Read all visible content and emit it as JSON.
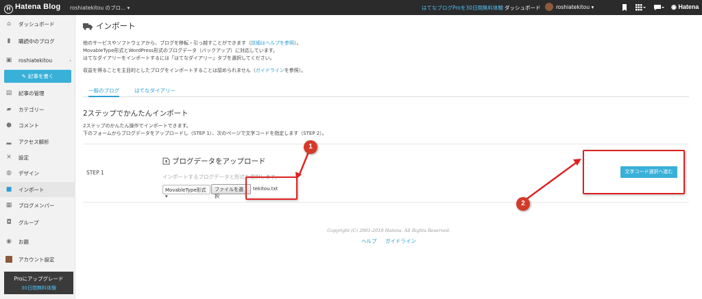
{
  "topbar": {
    "logo": "Hatena Blog",
    "blog_name": "roshiatekitou のブロ... ▾",
    "pro_trial": "はてなブログProを30日間無料体験",
    "dashboard": "ダッシュボード",
    "user": "roshiatekitou ▾",
    "brand": "Hatena"
  },
  "sidebar": {
    "items": [
      {
        "label": "ダッシュボード",
        "icon": "home-icon"
      },
      {
        "label": "購読中のブログ",
        "icon": "bookmark-icon"
      },
      {
        "label": "roshiatekitou",
        "icon": "blog-icon"
      },
      {
        "label": "記事の管理",
        "icon": "document-icon"
      },
      {
        "label": "カテゴリー",
        "icon": "folder-icon"
      },
      {
        "label": "コメント",
        "icon": "comment-icon"
      },
      {
        "label": "アクセス解析",
        "icon": "bar-chart-icon"
      },
      {
        "label": "設定",
        "icon": "wrench-icon"
      },
      {
        "label": "デザイン",
        "icon": "palette-icon"
      },
      {
        "label": "インポート",
        "icon": "truck-icon"
      },
      {
        "label": "ブログメンバー",
        "icon": "members-icon"
      },
      {
        "label": "グループ",
        "icon": "group-icon"
      },
      {
        "label": "お題",
        "icon": "topic-icon"
      },
      {
        "label": "アカウント設定",
        "icon": "avatar-icon"
      }
    ],
    "write_button": "記事を書く",
    "upgrade_title": "Proにアップグレード",
    "upgrade_sub": "30日間無料体験"
  },
  "main": {
    "title": "インポート",
    "desc1_a": "他のサービスやソフトウェアから、ブログを移転・引っ越すことができます（",
    "desc1_link": "詳細はヘルプを参照",
    "desc1_b": "）。",
    "desc2": "MovableType形式とWordPress形式のブログデータ（バックアップ）に対応しています。",
    "desc3": "はてなダイアリーをインポートするには「はてなダイアリー」タブを選択してください。",
    "desc4_a": "収益を得ることを主目的としたブログをインポートすることは認められません（",
    "desc4_link": "ガイドライン",
    "desc4_b": "を参照）。",
    "tabs": [
      "一般のブログ",
      "はてなダイアリー"
    ],
    "section_title": "2ステップでかんたんインポート",
    "section_desc1": "2ステップのかんたん操作でインポートできます。",
    "section_desc2": "下のフォームからブログデータをアップロードし（STEP 1）、次のページで文字コードを指定します（STEP 2）。",
    "step_label": "STEP 1",
    "upload_title": "ブログデータをアップロード",
    "upload_desc": "インポートするブログデータと形式を選択します。",
    "format_select": "MovableType形式 ▾",
    "file_button": "ファイルを選択",
    "file_name": "tekitou.txt",
    "next_button": "文字コード選択へ進む"
  },
  "footer": {
    "copyright": "Copyright (C) 2001-2018 Hatena. All Rights Reserved.",
    "links": [
      "ヘルプ",
      "ガイドライン"
    ]
  },
  "annotations": {
    "badge1": "1",
    "badge2": "2"
  },
  "colors": {
    "accent": "#39b0d8",
    "topbar": "#2b2b2b",
    "highlight": "#e02020"
  }
}
